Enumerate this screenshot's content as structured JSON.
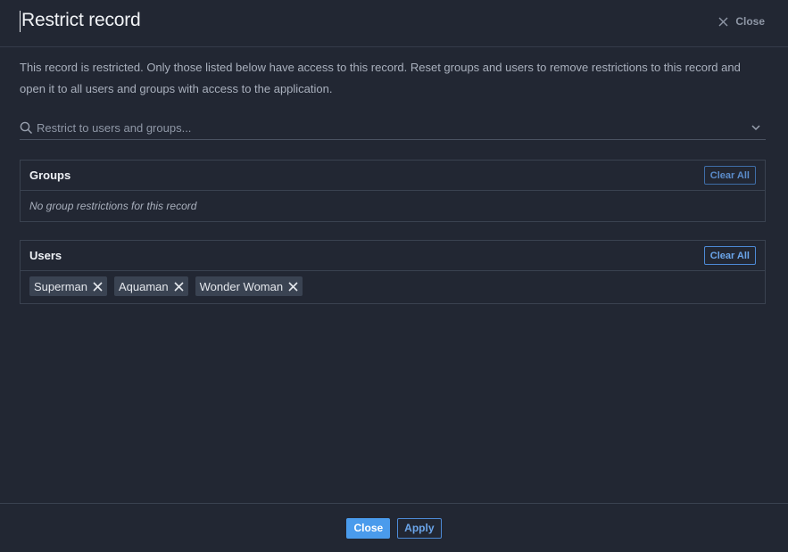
{
  "dialog": {
    "title": "Restrict record",
    "close_label": "Close"
  },
  "description": "This record is restricted. Only those listed below have access to this record. Reset groups and users to remove restrictions to this record and open it to all users and groups with access to the application.",
  "search": {
    "placeholder": "Restrict to users and groups..."
  },
  "groups": {
    "title": "Groups",
    "clear_label": "Clear All",
    "empty_text": "No group restrictions for this record"
  },
  "users": {
    "title": "Users",
    "clear_label": "Clear All",
    "items": [
      "Superman",
      "Aquaman",
      "Wonder Woman"
    ]
  },
  "footer": {
    "close_label": "Close",
    "apply_label": "Apply"
  },
  "colors": {
    "background": "#222733",
    "accent": "#4a9bec",
    "chip": "#3a4352"
  },
  "icons": [
    "close-icon",
    "search-icon",
    "chevron-down-icon",
    "remove-icon"
  ]
}
